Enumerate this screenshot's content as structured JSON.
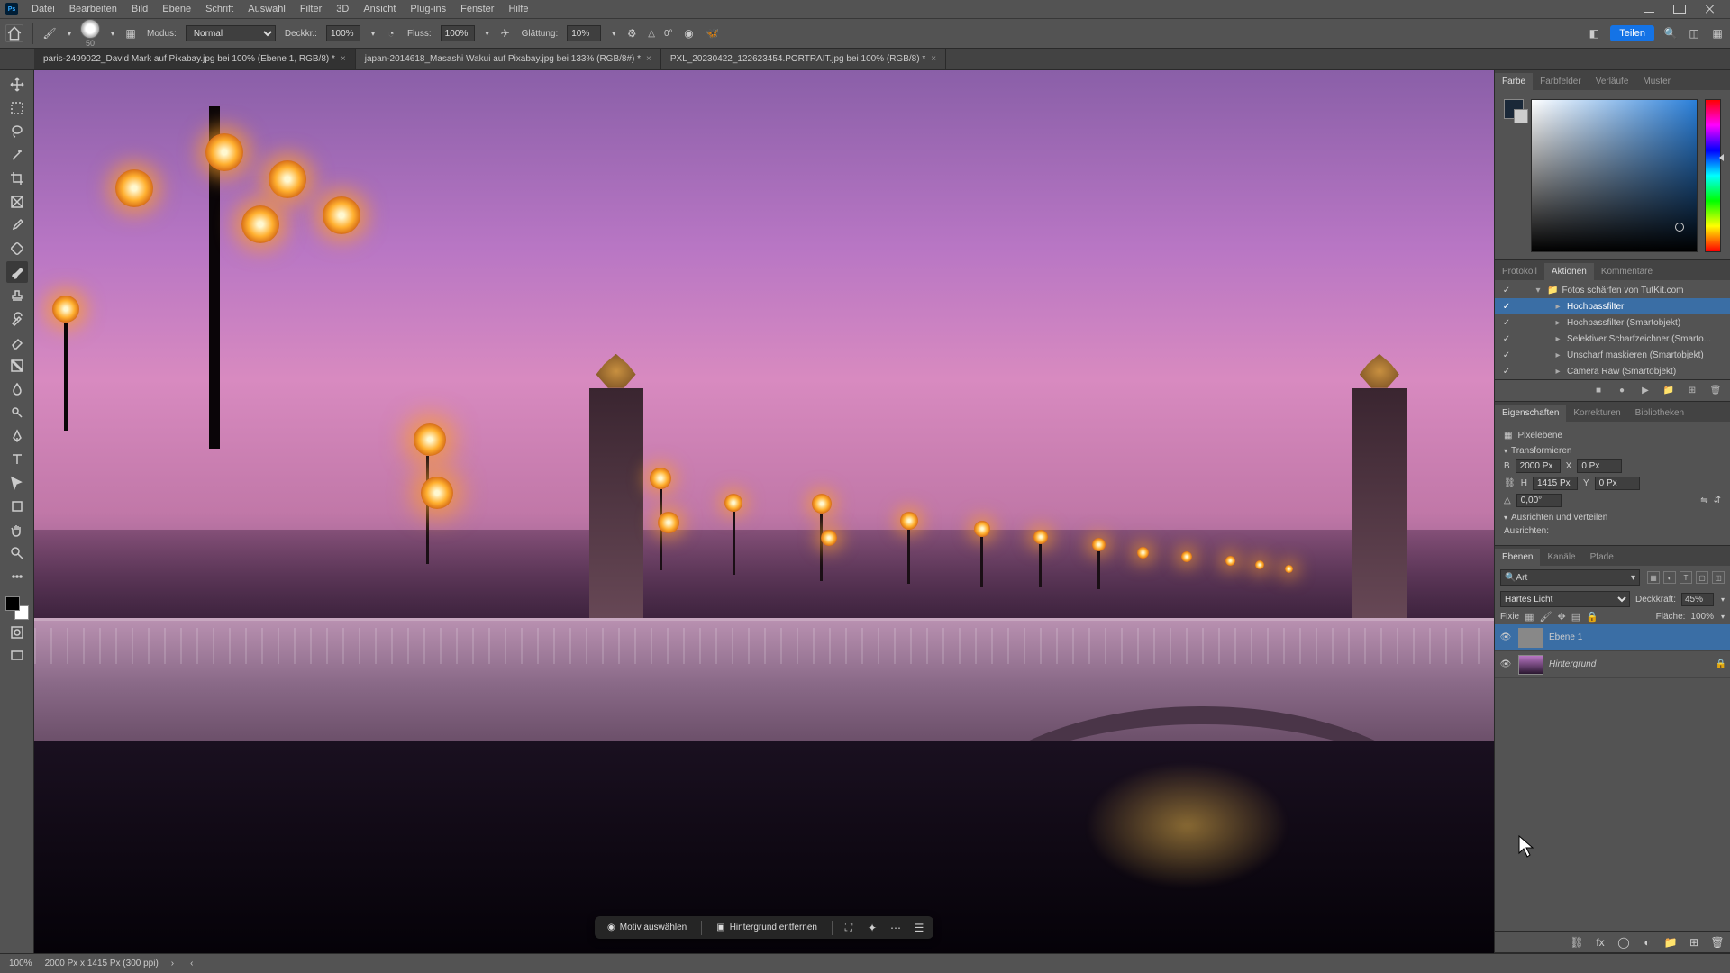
{
  "menu": [
    "Datei",
    "Bearbeiten",
    "Bild",
    "Ebene",
    "Schrift",
    "Auswahl",
    "Filter",
    "3D",
    "Ansicht",
    "Plug-ins",
    "Fenster",
    "Hilfe"
  ],
  "options": {
    "brush_size": "50",
    "mode_label": "Modus:",
    "mode_value": "Normal",
    "opacity_label": "Deckkr.:",
    "opacity_value": "100%",
    "flow_label": "Fluss:",
    "flow_value": "100%",
    "smoothing_label": "Glättung:",
    "smoothing_value": "10%",
    "angle_icon": "△",
    "angle_value": "0°",
    "share": "Teilen"
  },
  "tabs": [
    {
      "label": "paris-2499022_David Mark auf Pixabay.jpg bei 100% (Ebene 1, RGB/8) *",
      "active": true
    },
    {
      "label": "japan-2014618_Masashi Wakui auf Pixabay.jpg bei 133% (RGB/8#) *",
      "active": false
    },
    {
      "label": "PXL_20230422_122623454.PORTRAIT.jpg bei 100% (RGB/8) *",
      "active": false
    }
  ],
  "color_panel_tabs": [
    "Farbe",
    "Farbfelder",
    "Verläufe",
    "Muster"
  ],
  "actions_panel": {
    "tabs": [
      "Protokoll",
      "Aktionen",
      "Kommentare"
    ],
    "active_tab": 1,
    "folder": "Fotos schärfen von TutKit.com",
    "items": [
      {
        "name": "Hochpassfilter",
        "selected": true
      },
      {
        "name": "Hochpassfilter (Smartobjekt)",
        "selected": false
      },
      {
        "name": "Selektiver Scharfzeichner (Smarto...",
        "selected": false
      },
      {
        "name": "Unscharf maskieren (Smartobjekt)",
        "selected": false
      },
      {
        "name": "Camera Raw (Smartobjekt)",
        "selected": false
      }
    ]
  },
  "properties": {
    "tabs": [
      "Eigenschaften",
      "Korrekturen",
      "Bibliotheken"
    ],
    "kind": "Pixelebene",
    "transform_hdr": "Transformieren",
    "w_label": "B",
    "w_val": "2000 Px",
    "h_label": "H",
    "h_val": "1415 Px",
    "x_label": "X",
    "x_val": "0 Px",
    "y_label": "Y",
    "y_val": "0 Px",
    "angle": "0,00°",
    "align_hdr": "Ausrichten und verteilen",
    "align_label": "Ausrichten:"
  },
  "layers": {
    "tabs": [
      "Ebenen",
      "Kanäle",
      "Pfade"
    ],
    "filter": "Art",
    "blend": "Hartes Licht",
    "opacity_label": "Deckkraft:",
    "opacity": "45%",
    "lock_label": "Fixie",
    "fill_label": "Fläche:",
    "fill": "100%",
    "rows": [
      {
        "name": "Ebene 1",
        "selected": true,
        "locked": false,
        "italic": false
      },
      {
        "name": "Hintergrund",
        "selected": false,
        "locked": true,
        "italic": true
      }
    ]
  },
  "quickbar": {
    "select_subject": "Motiv auswählen",
    "remove_bg": "Hintergrund entfernen"
  },
  "status": {
    "zoom": "100%",
    "doc": "2000 Px x 1415 Px (300 ppi)"
  }
}
